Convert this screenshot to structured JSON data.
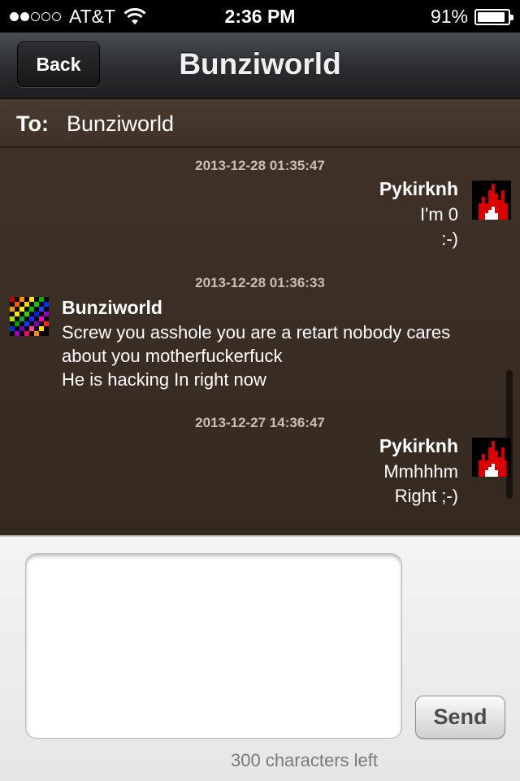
{
  "status_bar": {
    "carrier": "AT&T",
    "signal_bars_filled": 2,
    "signal_bars_total": 5,
    "time": "2:36 PM",
    "battery_percent": "91%",
    "battery_level": 0.91
  },
  "nav": {
    "back_label": "Back",
    "title": "Bunziworld"
  },
  "recipient": {
    "label": "To:",
    "value": "Bunziworld"
  },
  "messages": [
    {
      "timestamp": "2013-12-28 01:35:47",
      "sender": "Pykirknh",
      "side": "right",
      "avatar": "fire-icon",
      "lines": [
        "I'm 0",
        ":-)"
      ]
    },
    {
      "timestamp": "2013-12-28 01:36:33",
      "sender": "Bunziworld",
      "side": "left",
      "avatar": "rainbow-pixel-icon",
      "lines": [
        "Screw you asshole you are a retart nobody cares",
        "about you motherfuckerfuck",
        "He is hacking In right now"
      ]
    },
    {
      "timestamp": "2013-12-27 14:36:47",
      "sender": "Pykirknh",
      "side": "right",
      "avatar": "fire-icon",
      "lines": [
        "Mmhhhm",
        "Right ;-)"
      ]
    }
  ],
  "compose": {
    "input_value": "",
    "send_label": "Send",
    "chars_left": "300 characters left"
  },
  "colors": {
    "messages_bg": "#3a2d24",
    "nav_bg": "#2a2c2f",
    "compose_bg": "#eeeeee"
  }
}
